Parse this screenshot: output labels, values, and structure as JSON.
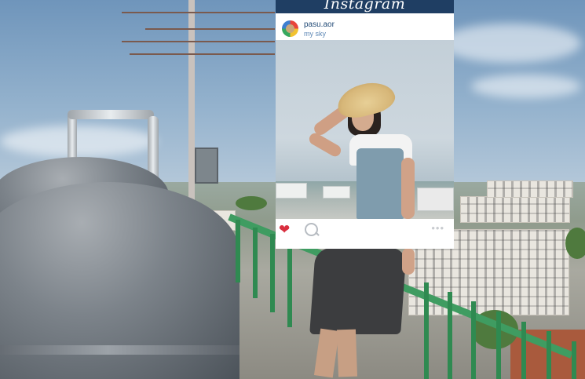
{
  "instagram_post": {
    "app_logo": "Instagram",
    "username": "pasu.aor",
    "caption": "my sky",
    "actions": {
      "like_icon": "heart-icon",
      "comment_icon": "comment-bubble-icon",
      "more_icon": "more-dots-icon",
      "more_glyph": "•••"
    },
    "colors": {
      "header_bar": "#1f3e63",
      "username_text": "#214a76",
      "caption_text": "#5d87b5",
      "heart": "#d92f3f"
    }
  }
}
